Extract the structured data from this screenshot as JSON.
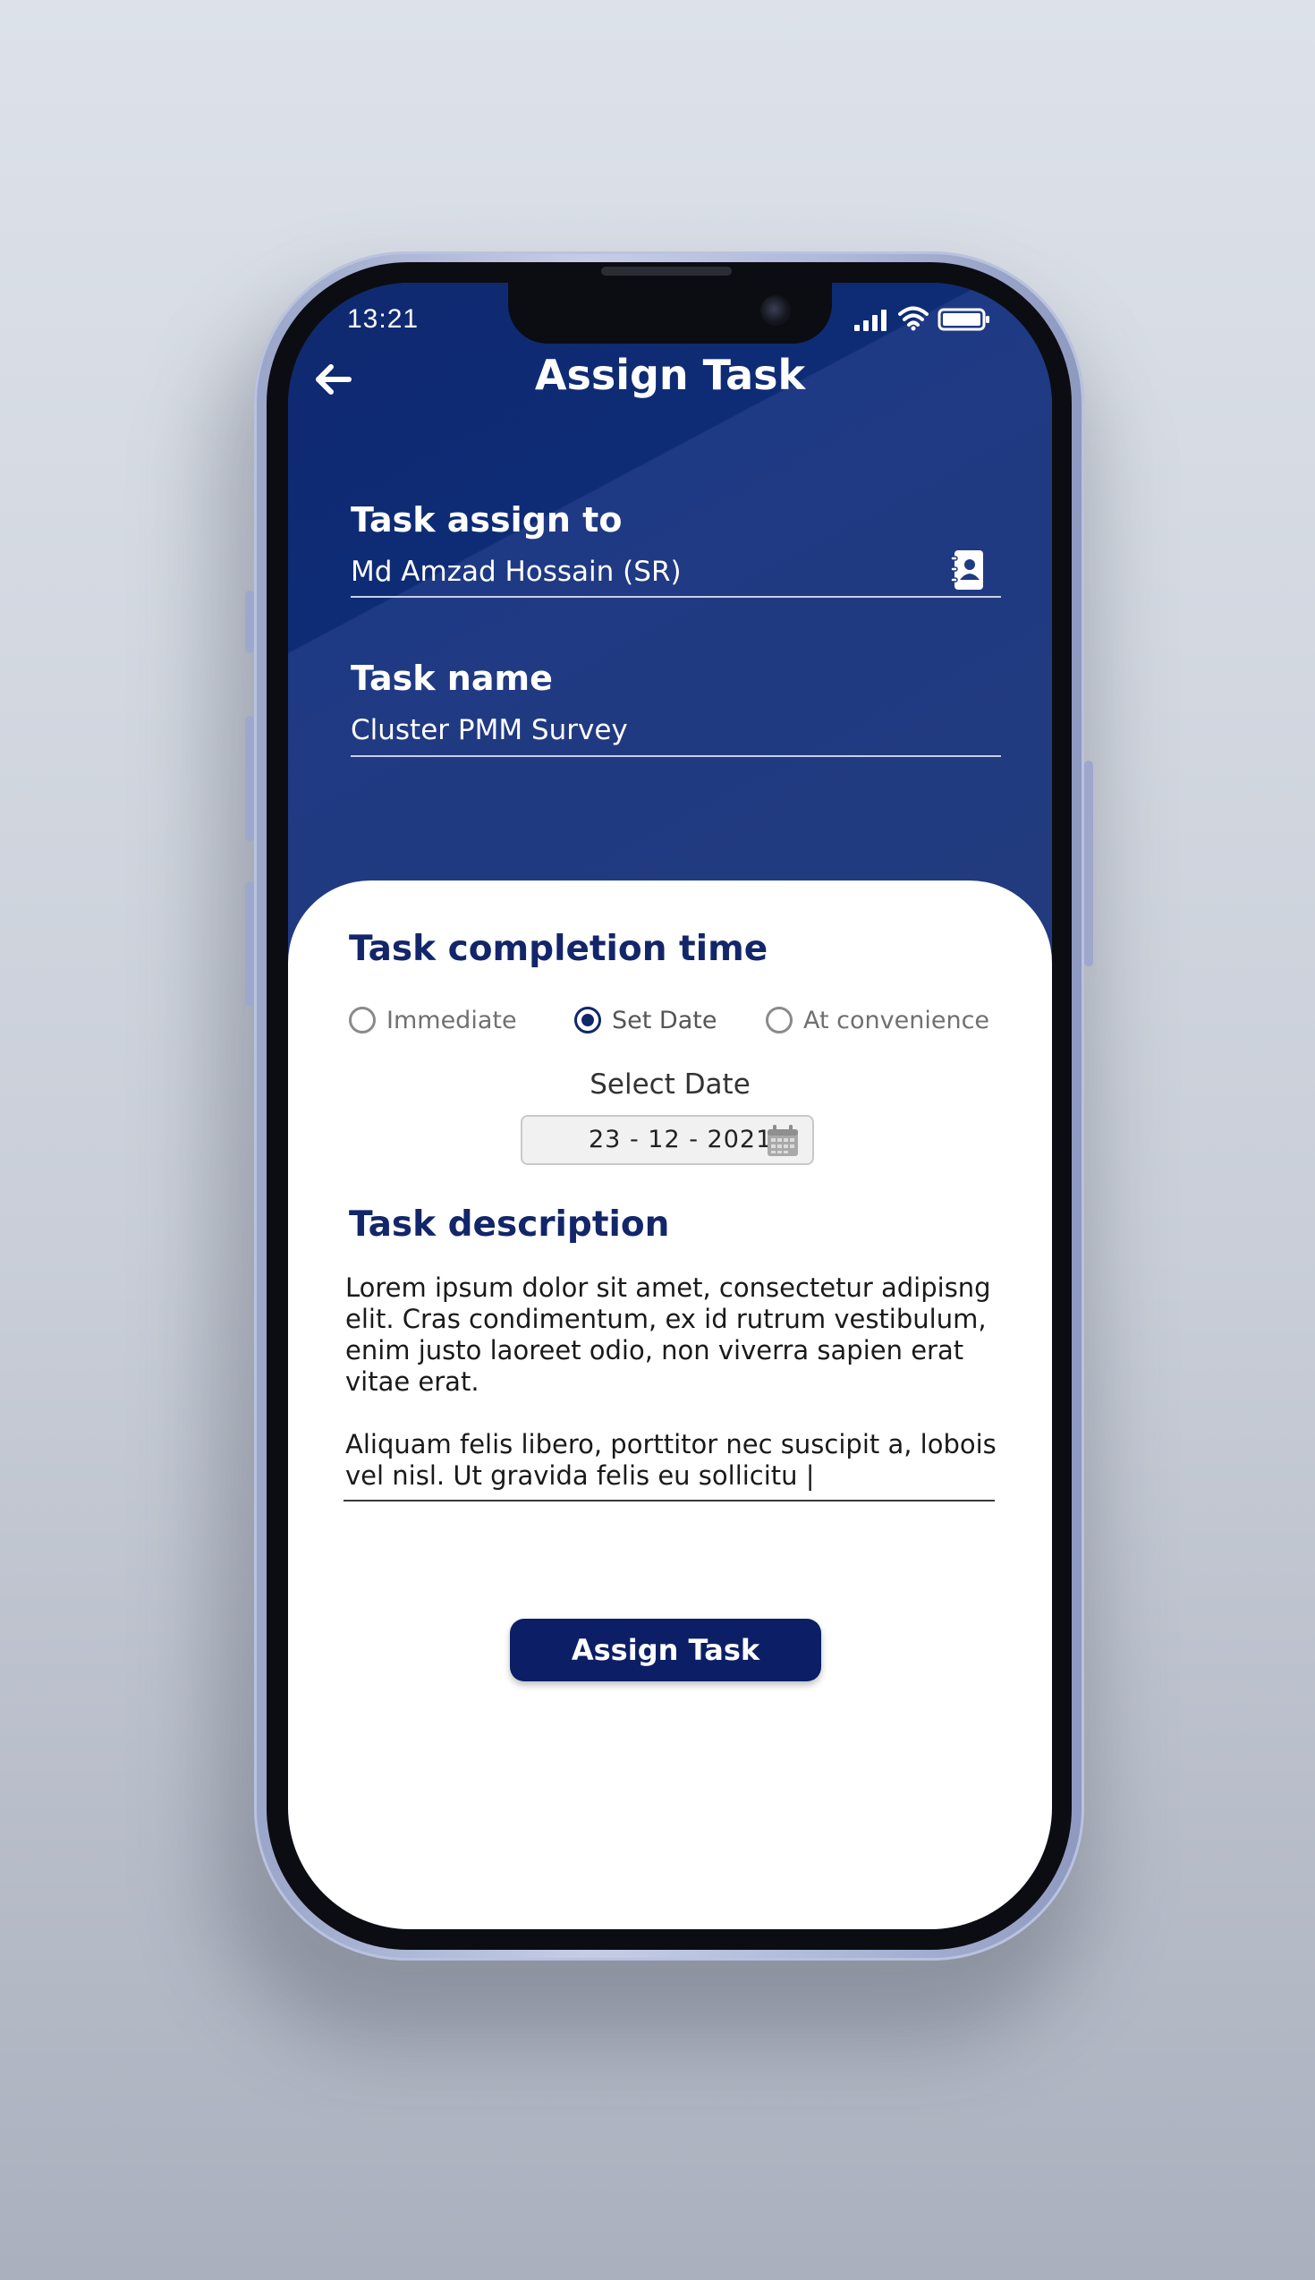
{
  "status_bar": {
    "time": "13:21",
    "signal_icon": "cellular-signal-icon",
    "wifi_icon": "wifi-icon",
    "battery_icon": "battery-icon"
  },
  "header": {
    "title": "Assign Task",
    "back_icon": "arrow-left-icon"
  },
  "form": {
    "assign_to": {
      "label": "Task assign to",
      "value": "Md Amzad Hossain (SR)",
      "icon": "contact-book-icon"
    },
    "task_name": {
      "label": "Task name",
      "value": "Cluster PMM Survey"
    }
  },
  "completion": {
    "title": "Task completion time",
    "options": [
      {
        "label": "Immediate",
        "selected": false
      },
      {
        "label": "Set Date",
        "selected": true
      },
      {
        "label": "At convenience",
        "selected": false
      }
    ],
    "select_date_label": "Select Date",
    "date_value": "23 - 12 - 2021",
    "calendar_icon": "calendar-icon"
  },
  "description": {
    "title": "Task description",
    "text": "Lorem ipsum dolor sit amet, consectetur adipisng\nelit. Cras condimentum, ex id rutrum vestibulum,\nenim justo laoreet odio, non viverra sapien erat\nvitae erat.\n\nAliquam felis libero, porttitor nec suscipit a, lobois\nvel nisl. Ut gravida felis eu sollicitu |"
  },
  "actions": {
    "assign_button_label": "Assign Task"
  },
  "colors": {
    "brand_navy": "#13266a",
    "header_blue": "#1f3a84",
    "button_navy": "#0c1f66"
  }
}
